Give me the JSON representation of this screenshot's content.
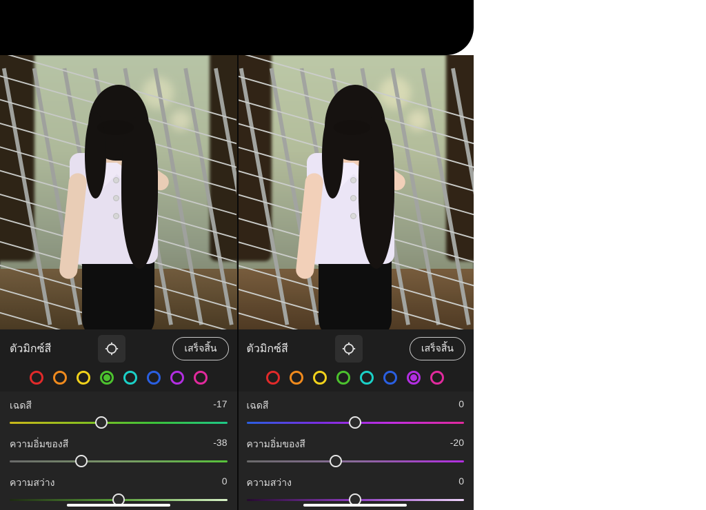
{
  "colors": {
    "red": "#e12a2a",
    "orange": "#f08a1d",
    "yellow": "#f2d21b",
    "green": "#4cc22e",
    "aqua": "#1bd0c7",
    "blue": "#2a5fe1",
    "purple": "#b22ee1",
    "magenta": "#e12a9d"
  },
  "panels": [
    {
      "side": "left",
      "toolbar": {
        "title": "ตัวมิกซ์สี",
        "done": "เสร็จสิ้น"
      },
      "selected_color": "green",
      "sliders": {
        "hue": {
          "label": "เฉดสี",
          "value": -17,
          "pos": 0.42,
          "grad": "linear-gradient(90deg,#cbb81a,#8bbf1f,#3cc23a,#1ec888)"
        },
        "sat": {
          "label": "ความอิ่มของสี",
          "value": -38,
          "pos": 0.33,
          "grad": "linear-gradient(90deg,#6a6a6a,#7a9968,#57c23a)"
        },
        "lum": {
          "label": "ความสว่าง",
          "value": 0,
          "pos": 0.5,
          "grad": "linear-gradient(90deg,#1d2a12,#5aa03a,#d8f2c7)"
        }
      }
    },
    {
      "side": "right",
      "toolbar": {
        "title": "ตัวมิกซ์สี",
        "done": "เสร็จสิ้น"
      },
      "selected_color": "purple",
      "sliders": {
        "hue": {
          "label": "เฉดสี",
          "value": 0,
          "pos": 0.5,
          "grad": "linear-gradient(90deg,#2a5fe1,#7a2ee1,#c22ee1,#e12a9d)"
        },
        "sat": {
          "label": "ความอิ่มของสี",
          "value": -20,
          "pos": 0.41,
          "grad": "linear-gradient(90deg,#6a6a6a,#8a6a9b,#b22ee1)"
        },
        "lum": {
          "label": "ความสว่าง",
          "value": 0,
          "pos": 0.5,
          "grad": "linear-gradient(90deg,#250a2e,#8e3bc0,#efd5fb)"
        }
      }
    }
  ]
}
